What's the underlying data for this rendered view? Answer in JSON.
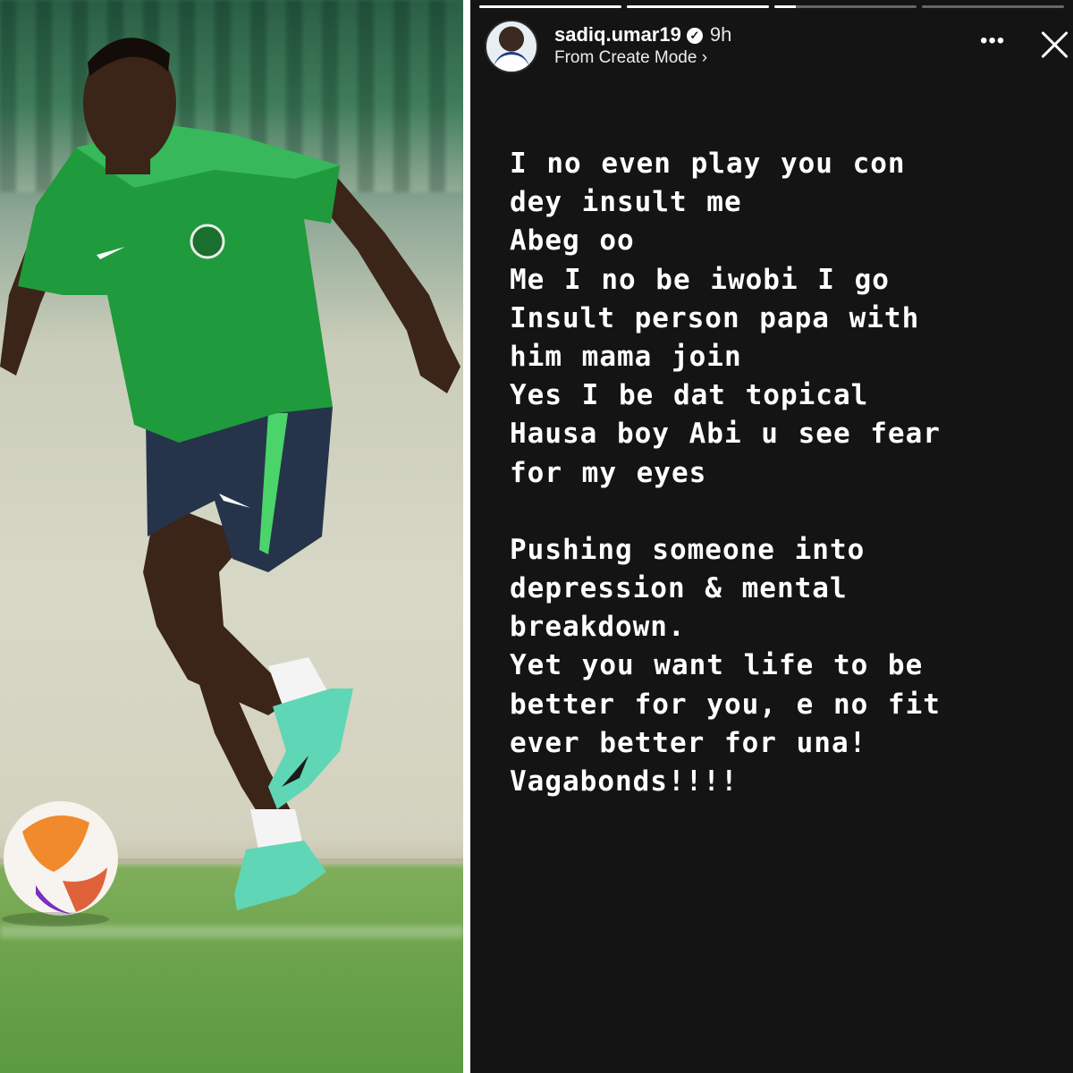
{
  "story": {
    "username": "sadiq.umar19",
    "verified_icon": "verified-badge-icon",
    "time_ago": "9h",
    "subline": "From Create Mode ›",
    "more_icon": "•••",
    "close_icon": "close-icon",
    "progress": [
      1,
      1,
      0.15,
      0
    ],
    "lines": [
      "I no even play you con",
      "dey insult me",
      "Abeg oo",
      "Me I no be iwobi I go",
      "Insult person papa with",
      "him mama join",
      "Yes I be dat topical",
      "Hausa boy Abi u see fear",
      "for my eyes",
      "",
      "Pushing someone into",
      "depression & mental",
      "breakdown.",
      "Yet you want life to be",
      "better for you, e no fit",
      "ever better for una!",
      "Vagabonds!!!!"
    ]
  },
  "colors": {
    "story_background": "#141414",
    "jersey_green": "#1f9a3c",
    "shorts_navy": "#25344a",
    "boot_mint": "#5fd6b5"
  }
}
